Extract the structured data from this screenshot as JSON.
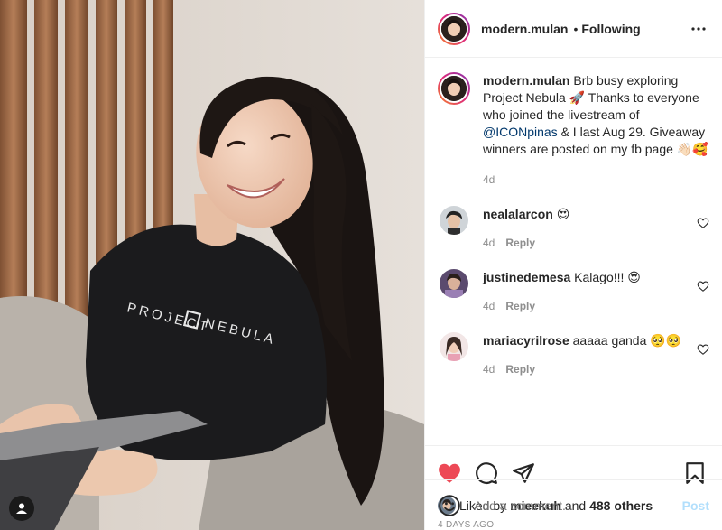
{
  "post": {
    "username": "modern.mulan",
    "follow_separator": "•",
    "follow_label": "Following",
    "more_icon": "more-dots-icon",
    "photo_shirt_text": "PROJECT NEBULA",
    "caption": {
      "username": "modern.mulan",
      "text_before_mention": "Brb busy exploring Project Nebula 🚀 Thanks to everyone who joined the livestream of ",
      "mention": "@ICONpinas",
      "text_after_mention": " & I last Aug 29. Giveaway winners are posted on my fb page 👋🏻🥰",
      "time": "4d"
    },
    "comments": [
      {
        "username": "nealalarcon",
        "text": "😍",
        "time": "4d",
        "reply_label": "Reply"
      },
      {
        "username": "justinedemesa",
        "text": "Kalago!!! 😍",
        "time": "4d",
        "reply_label": "Reply"
      },
      {
        "username": "mariacyrilrose",
        "text": "aaaaa ganda 🥺🥺",
        "time": "4d",
        "reply_label": "Reply"
      }
    ],
    "likes": {
      "prefix": "Liked by ",
      "user": "mieekuh",
      "middle": " and ",
      "others": "488 others"
    },
    "date": "4 DAYS AGO",
    "add_comment": {
      "placeholder": "Add a comment...",
      "post_label": "Post"
    },
    "colors": {
      "like_red": "#ed4956",
      "link_blue": "#00376b",
      "post_disabled": "#b2dffc",
      "muted": "#8e8e8e"
    }
  }
}
